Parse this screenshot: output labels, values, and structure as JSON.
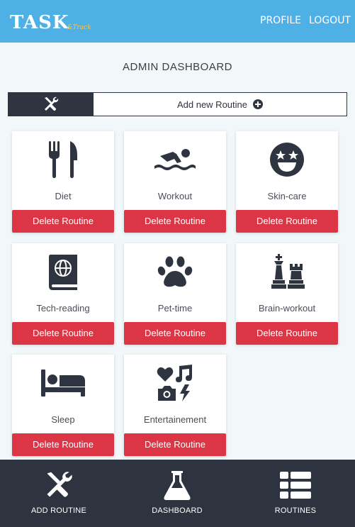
{
  "header": {
    "logo_main": "TASK",
    "logo_sub": "&Track",
    "nav": {
      "profile": "PROFILE",
      "logout": "LOGOUT"
    },
    "bg_color": "#4fb0e6"
  },
  "page": {
    "title": "ADMIN DASHBOARD"
  },
  "add_bar": {
    "icon": "tools-icon",
    "label": "Add new Routine",
    "plus_icon": "plus-circle-icon"
  },
  "routines": [
    {
      "name": "Diet",
      "icon": "utensils-icon",
      "delete_label": "Delete Routine"
    },
    {
      "name": "Workout",
      "icon": "swimmer-icon",
      "delete_label": "Delete Routine"
    },
    {
      "name": "Skin-care",
      "icon": "star-eyes-face-icon",
      "delete_label": "Delete Routine"
    },
    {
      "name": "Tech-reading",
      "icon": "globe-book-icon",
      "delete_label": "Delete Routine"
    },
    {
      "name": "Pet-time",
      "icon": "paw-icon",
      "delete_label": "Delete Routine"
    },
    {
      "name": "Brain-workout",
      "icon": "chess-icon",
      "delete_label": "Delete Routine"
    },
    {
      "name": "Sleep",
      "icon": "bed-icon",
      "delete_label": "Delete Routine"
    },
    {
      "name": "Entertainement",
      "icon": "icons-icon",
      "delete_label": "Delete Routine"
    }
  ],
  "bottom_nav": [
    {
      "label": "ADD ROUTINE",
      "icon": "tools-icon"
    },
    {
      "label": "DASHBOARD",
      "icon": "flask-icon"
    },
    {
      "label": "ROUTINES",
      "icon": "list-icon"
    }
  ],
  "colors": {
    "danger": "#dc3545",
    "dark": "#2e343f",
    "icon": "#2f3540"
  }
}
